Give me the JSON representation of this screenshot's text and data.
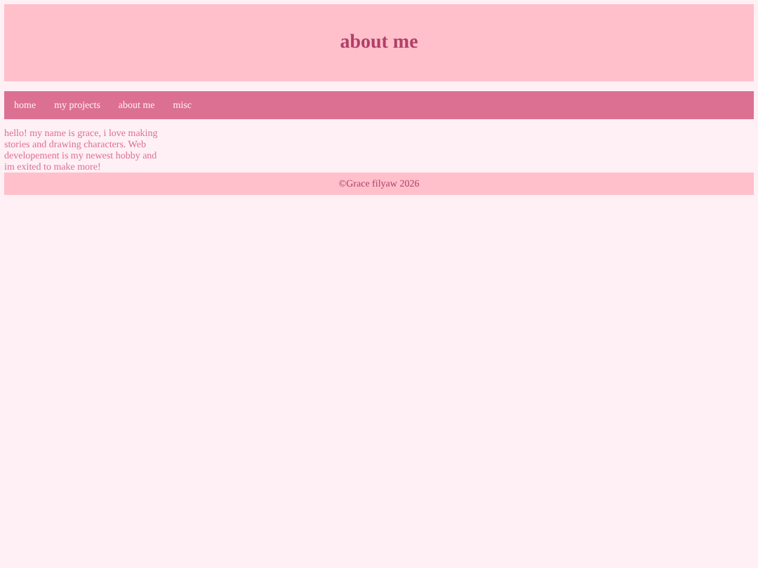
{
  "header": {
    "title": "about me"
  },
  "nav": {
    "items": [
      {
        "label": "home"
      },
      {
        "label": "my projects"
      },
      {
        "label": "about me"
      },
      {
        "label": "misc"
      }
    ]
  },
  "intro": "hello! my name is grace, i love making stories and drawing characters. Web developement is my newest hobby and im exited to make more!",
  "footer": "©Grace filyaw 2026"
}
